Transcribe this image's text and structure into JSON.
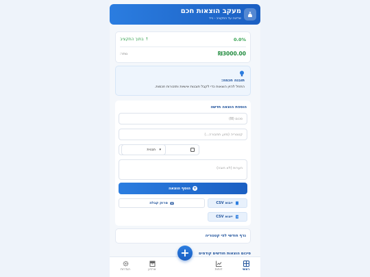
{
  "header": {
    "title": "מעקב הוצאות חכם",
    "subtitle": "שליטה על התקציב - נייד"
  },
  "budget": {
    "percent": "0.0%",
    "status": "בתוך התקציב",
    "amount": "₪3000.00",
    "remaining_label": "נותר:"
  },
  "tip": {
    "title": "תובנה חכמה:",
    "text": "התחל להזין הוצאות כדי לקבל תובנות אישיות ותזכורות חכמות."
  },
  "form": {
    "title": "הוספת הוצאה חדשה",
    "amount_placeholder": "סכום (₪)",
    "category_placeholder": "קטגוריה (מזון, תחבורה...)",
    "date_value": "10/29/2025",
    "select_value": "תבנית",
    "note_placeholder": "הערות (לא חובה)",
    "add_label": "הוסף הוצאה",
    "import_label": "ייבוא CSV",
    "receipt_label": "סרוק קבלה",
    "export_label": "ייצוא CSV"
  },
  "chart_card": {
    "title": "גרף חודשי לפי קטגוריה"
  },
  "previous": {
    "title": "סיכום הוצאות חודשים קודמים"
  },
  "fab": {
    "label": "+"
  },
  "nav": {
    "home": "ראשי",
    "stats": "דוחות",
    "archive": "ארכיון",
    "settings": "הגדרות"
  },
  "colors": {
    "primary": "#1b5fc2",
    "success": "#2e9e4a"
  }
}
